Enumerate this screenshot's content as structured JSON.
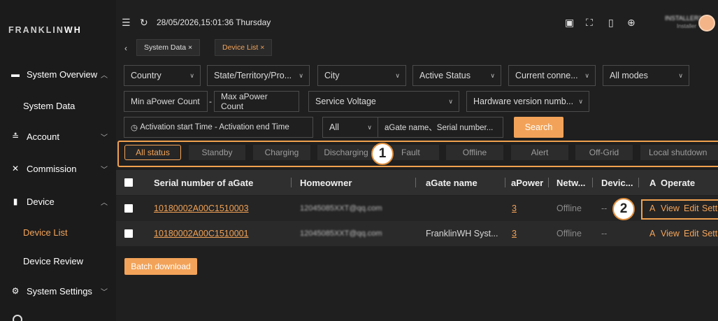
{
  "brand": {
    "logo_prefix": "FRANKLIN",
    "logo_suffix": "WH"
  },
  "sidebar": {
    "items": [
      {
        "label": "System Overview",
        "icon": "monitor-icon"
      },
      {
        "label": "System Data"
      },
      {
        "label": "Account",
        "icon": "user-list-icon"
      },
      {
        "label": "Commission",
        "icon": "tools-icon"
      },
      {
        "label": "Device",
        "icon": "device-icon"
      },
      {
        "label": "Device List"
      },
      {
        "label": "Device Review"
      },
      {
        "label": "System Settings",
        "icon": "gear-icon"
      }
    ]
  },
  "header": {
    "datetime": "28/05/2026,15:01:36 Thursday",
    "user_name": "INSTALLER1",
    "user_role": "Installer"
  },
  "tabs": [
    {
      "label": "System Data",
      "close": "×"
    },
    {
      "label": "Device List",
      "close": "×"
    }
  ],
  "filters": {
    "country": "Country",
    "state": "State/Territory/Pro...",
    "city": "City",
    "active_status": "Active Status",
    "current_connection": "Current conne...",
    "all_modes": "All modes",
    "min_apower": "Min aPower Count",
    "range_sep": "-",
    "max_apower": "Max aPower Count",
    "service_voltage": "Service Voltage",
    "hardware_version": "Hardware version numb...",
    "activation_time": "Activation start Time  -  Activation end Time",
    "all": "All",
    "search_placeholder": "aGate name、Serial number...",
    "search_button": "Search"
  },
  "status_chips": [
    "All status",
    "Standby",
    "Charging",
    "Discharging",
    "Fault",
    "Offline",
    "Alert",
    "Off-Grid",
    "Local shutdown"
  ],
  "callouts": [
    "1",
    "2"
  ],
  "table": {
    "columns": [
      "Serial number of aGate",
      "Homeowner",
      "aGate name",
      "aPower",
      "Netw...",
      "Devic...",
      "A",
      "Operate"
    ],
    "rows": [
      {
        "serial": "10180002A00C1510003",
        "homeowner": "12045085XXT@qq.com",
        "agate_name": "",
        "apower": "3",
        "network": "Offline",
        "device": "--",
        "a": "A",
        "ops": [
          "View",
          "Edit",
          "Setting"
        ]
      },
      {
        "serial": "10180002A00C1510001",
        "homeowner": "12045085XXT@qq.com",
        "agate_name": "FranklinWH Syst...",
        "apower": "3",
        "network": "Offline",
        "device": "--",
        "a": "A",
        "ops": [
          "View",
          "Edit",
          "Setting"
        ]
      }
    ]
  },
  "batch_download": "Batch download",
  "colors": {
    "accent": "#f2a359",
    "background": "#1f1f1f",
    "sidebar": "#1b1b1b",
    "header_row": "#2f2f2f"
  }
}
